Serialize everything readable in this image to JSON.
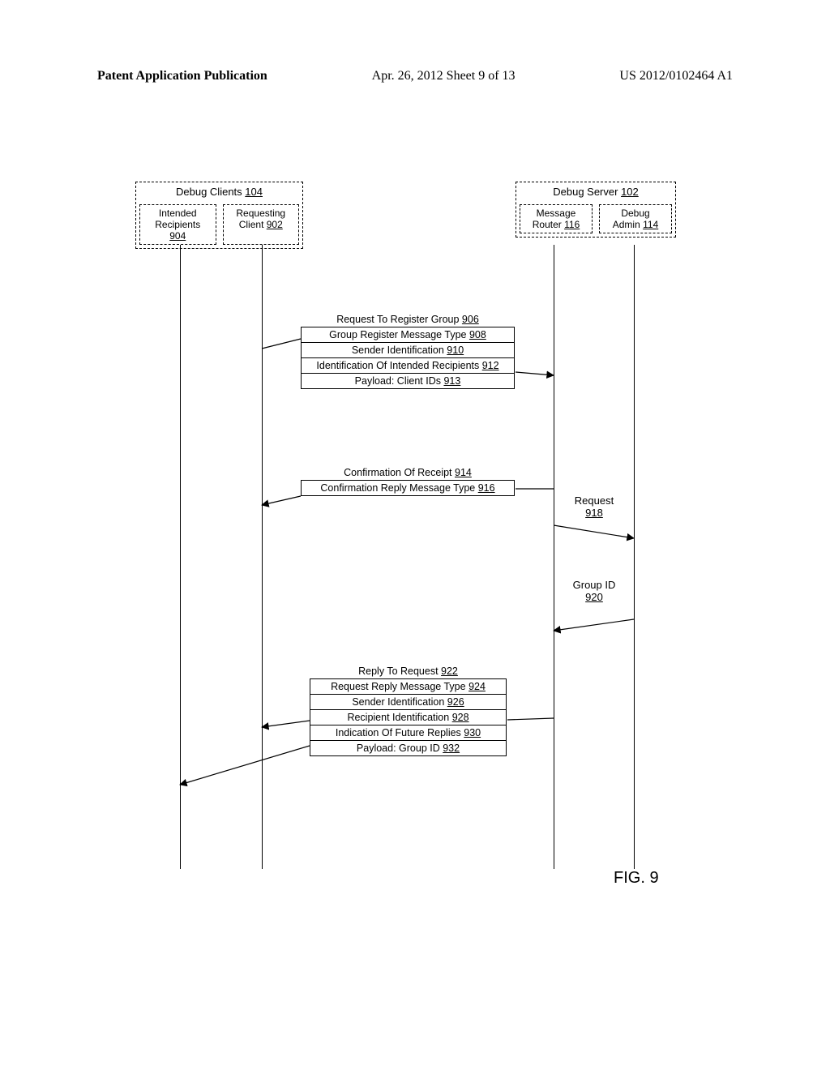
{
  "header": {
    "left": "Patent Application Publication",
    "center": "Apr. 26, 2012  Sheet 9 of 13",
    "right": "US 2012/0102464 A1"
  },
  "clients": {
    "title": "Debug Clients ",
    "title_ref": "104",
    "intended": "Intended\nRecipients ",
    "intended_ref": "904",
    "requesting": "Requesting\nClient ",
    "requesting_ref": "902"
  },
  "server": {
    "title": "Debug Server ",
    "title_ref": "102",
    "router": "Message\nRouter ",
    "router_ref": "116",
    "admin": "Debug\nAdmin ",
    "admin_ref": "114"
  },
  "msg1": {
    "title": "Request To Register Group ",
    "title_ref": "906",
    "r1": "Group Register Message Type ",
    "r1_ref": "908",
    "r2": "Sender Identification ",
    "r2_ref": "910",
    "r3": "Identification Of Intended Recipients ",
    "r3_ref": "912",
    "r4": "Payload: Client IDs ",
    "r4_ref": "913"
  },
  "msg2": {
    "title": "Confirmation Of Receipt ",
    "title_ref": "914",
    "r1": "Confirmation Reply Message Type ",
    "r1_ref": "916"
  },
  "req": {
    "label": "Request\n",
    "ref": "918"
  },
  "gid": {
    "label": "Group ID\n",
    "ref": "920"
  },
  "msg3": {
    "title": "Reply To Request ",
    "title_ref": "922",
    "r1": "Request Reply Message Type ",
    "r1_ref": "924",
    "r2": "Sender Identification ",
    "r2_ref": "926",
    "r3": "Recipient Identification ",
    "r3_ref": "928",
    "r4": "Indication Of Future Replies ",
    "r4_ref": "930",
    "r5": "Payload: Group ID ",
    "r5_ref": "932"
  },
  "fig": "FIG. 9"
}
